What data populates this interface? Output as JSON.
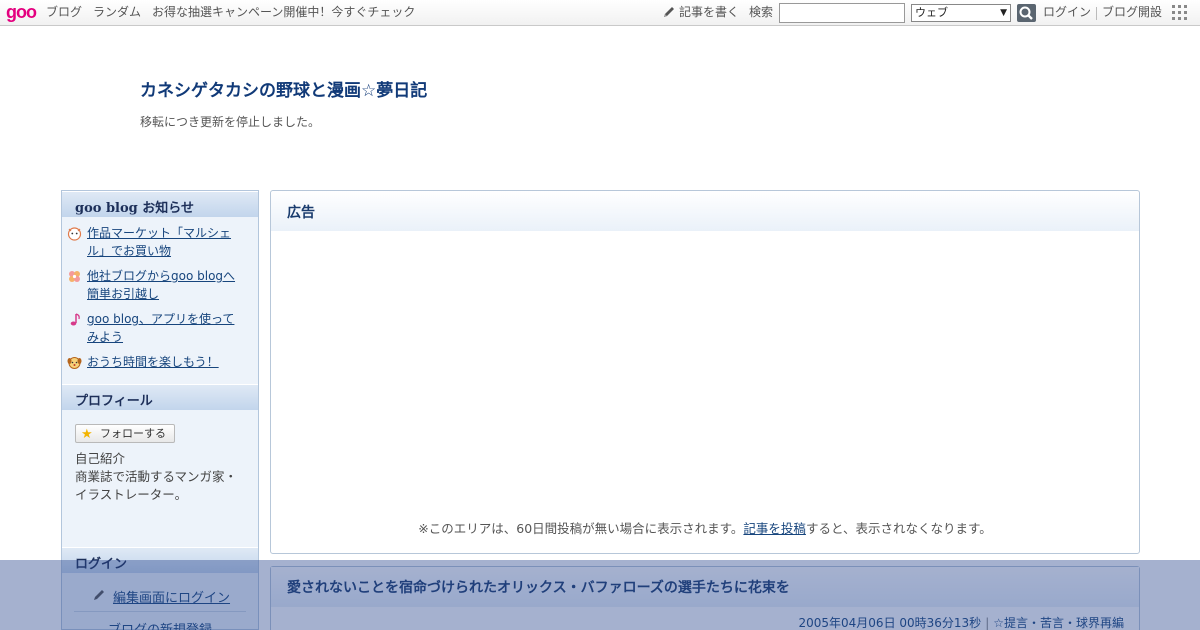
{
  "toolbar": {
    "logo": "goo",
    "links": [
      "ブログ",
      "ランダム",
      "お得な抽選キャンペーン開催中！今すぐチェック"
    ],
    "write_label": "記事を書く",
    "search_label": "検索",
    "search_value": "",
    "scope_value": "ウェブ",
    "login": "ログイン",
    "blog_open": "ブログ開設"
  },
  "blog": {
    "title": "カネシゲタカシの野球と漫画☆夢日記",
    "description": "移転につき更新を停止しました。"
  },
  "sidebar": {
    "notice_heading": "goo blog お知らせ",
    "notices": [
      {
        "line1": "作品マーケット「マルシェ",
        "line2": "ル」でお買い物"
      },
      {
        "line1": "他社ブログからgoo blogへ",
        "line2": "簡単お引越し"
      },
      {
        "line1": "goo blog、アプリを使って",
        "line2": "みよう"
      },
      {
        "line1": "おうち時間を楽しもう！",
        "line2": ""
      }
    ],
    "profile_heading": "プロフィール",
    "follow_button": "フォローする",
    "intro_label": "自己紹介",
    "intro_line1": "商業誌で活動するマンガ家・",
    "intro_line2": "イラストレーター。",
    "login_heading": "ログイン",
    "login_edit": "編集画面にログイン",
    "new_blog": "ブログの新規登録"
  },
  "ad": {
    "heading": "広告",
    "note_before": "※このエリアは、60日間投稿が無い場合に表示されます。",
    "note_link": "記事を投稿",
    "note_after": "すると、表示されなくなります。"
  },
  "post": {
    "title": "愛されないことを宿命づけられたオリックス・バファローズの選手たちに花束を",
    "datetime": "2005年04月06日 00時36分13秒",
    "category": "☆提言・苦言・球界再編"
  },
  "colors": {
    "logo": "#e4007f",
    "title": "#113a78",
    "link": "#17457d",
    "sidebar_bg": "#edf3fa",
    "overlay": "#28468c"
  }
}
